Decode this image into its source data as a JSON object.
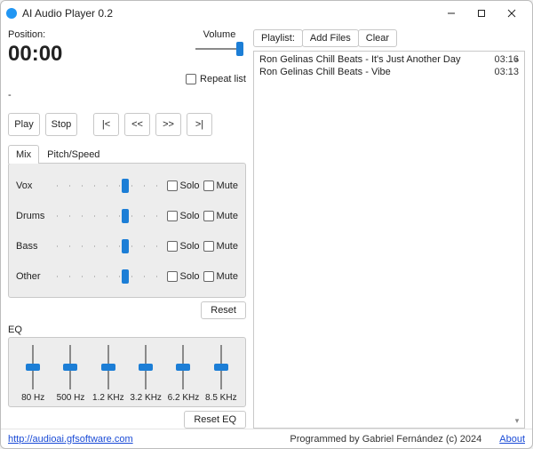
{
  "window": {
    "title": "AI Audio Player 0.2"
  },
  "position": {
    "label": "Position:",
    "time": "00:00",
    "status": "-"
  },
  "volume": {
    "label": "Volume",
    "value_pct": 92
  },
  "repeat": {
    "label": "Repeat list",
    "checked": false
  },
  "transport": {
    "play": "Play",
    "stop": "Stop",
    "first": "|<",
    "prev": "<<",
    "next": ">>",
    "last": ">|"
  },
  "tabs": {
    "mix": "Mix",
    "pitch": "Pitch/Speed"
  },
  "mix": {
    "tracks": [
      {
        "name": "Vox",
        "value_pct": 68,
        "solo": "Solo",
        "mute": "Mute"
      },
      {
        "name": "Drums",
        "value_pct": 68,
        "solo": "Solo",
        "mute": "Mute"
      },
      {
        "name": "Bass",
        "value_pct": 68,
        "solo": "Solo",
        "mute": "Mute"
      },
      {
        "name": "Other",
        "value_pct": 68,
        "solo": "Solo",
        "mute": "Mute"
      }
    ],
    "reset": "Reset"
  },
  "eq": {
    "label": "EQ",
    "bands": [
      {
        "freq": "80 Hz",
        "value_pct": 50
      },
      {
        "freq": "500 Hz",
        "value_pct": 50
      },
      {
        "freq": "1.2 KHz",
        "value_pct": 50
      },
      {
        "freq": "3.2 KHz",
        "value_pct": 50
      },
      {
        "freq": "6.2 KHz",
        "value_pct": 50
      },
      {
        "freq": "8.5 KHz",
        "value_pct": 50
      }
    ],
    "reset": "Reset EQ"
  },
  "playlist": {
    "tabs": {
      "playlist": "Playlist:",
      "add": "Add Files",
      "clear": "Clear"
    },
    "items": [
      {
        "title": "Ron Gelinas Chill Beats - It's Just Another Day",
        "duration": "03:16"
      },
      {
        "title": "Ron Gelinas Chill Beats - Vibe",
        "duration": "03:13"
      }
    ]
  },
  "footer": {
    "url": "http://audioai.gfsoftware.com",
    "credit": "Programmed by Gabriel Fernández (c) 2024",
    "about": "About"
  }
}
